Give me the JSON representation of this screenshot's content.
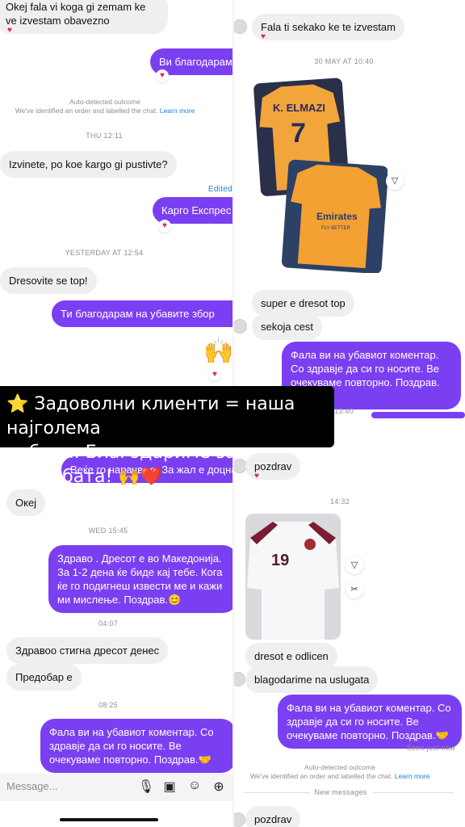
{
  "left": {
    "m1": "Okej fala vi koga gi zemam ke ve izvestam obavezno",
    "m2": "Ви благодарам",
    "sys_title": "Auto-detected outcome",
    "sys_body": "We've identified an order and labelled the chat.",
    "sys_link": "Learn more",
    "ts1": "THU 12:11",
    "m3": "Izvinete, po koe kargo gi pustivte?",
    "edited": "Edited",
    "m4": "Карго Експрес",
    "ts2": "YESTERDAY AT 12:54",
    "m5": "Dresovite se top!",
    "m6": "Ти благодарам на убавите збор",
    "emoji_hands": "🙌",
    "m7": "Веќе го нарачвме. За жал е доцна.",
    "m8": "Океј",
    "ts3": "WED 15:45",
    "m9": "Здраво . Дресот е во Македонија. За 1-2 дена ќе биде кај тебе. Кога ќе го подигнеш извести ме и кажи ми мислење. Поздрав.😊",
    "ts4": "04:07",
    "m10": "Здравоо стигна дресот денес",
    "m11": "Предобар е",
    "ts5": "08:25",
    "m12": "Фала ви на убавиот коментар. Со здравје да си го носите. Ве очекуваме повторно. Поздрав.🤝",
    "message_placeholder": "Message..."
  },
  "banner": {
    "line1": "⭐ Задоволни клиенти = наша најголема",
    "line2": "победа. Благодариме за довербата! 🙌❤️"
  },
  "right": {
    "m1": "Fala ti sekako ke te izvestam",
    "ts1": "30 MAY AT 10:40",
    "jersey1_name": "K. ELMAZI",
    "jersey1_number": "7",
    "jersey2_brand": "Emirates",
    "jersey2_sub": "FLY BETTER",
    "m2": "super e dresot top",
    "m3": "sekoja cest",
    "m4": "Фала ви на убавиот коментар. Со здравје да си го носите. Ве очекуваме повторно. Поздрав.🤝",
    "ts2": "13:40",
    "m5": "pozdrav",
    "ts3": "14:32",
    "jersey3_number": "19",
    "m6": "dresot e odlicen",
    "m7": "blagodarime na uslugata",
    "m8": "Фала ви на убавиот коментар. Со здравје да си го носите. Ве очекуваме повторно. Поздрав.🤝",
    "seen": "Seen just now",
    "sys_title": "Auto-detected outcome",
    "sys_body": "We've identified an order and labelled the chat.",
    "sys_link": "Learn more",
    "new_messages": "New messages",
    "m9": "pozdrav"
  },
  "colors": {
    "outgoing": "#7b3ff2",
    "incoming": "#efeff2",
    "heart": "#e0245e",
    "link": "#1d7fe0"
  }
}
